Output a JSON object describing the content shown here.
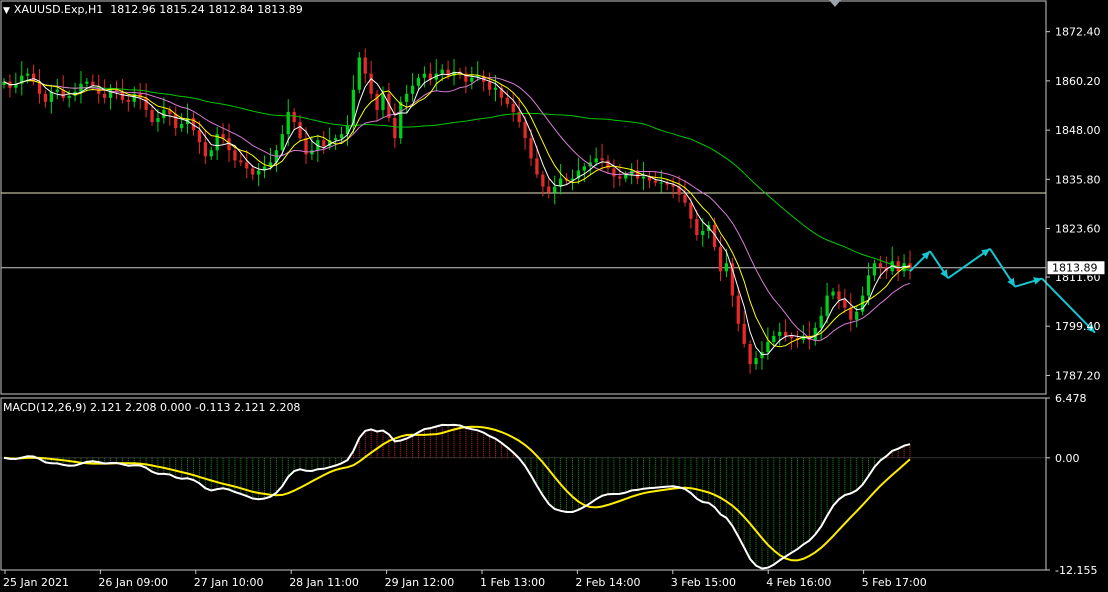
{
  "header": {
    "symbol_label": "XAUUSD.Exp,H1",
    "ohlc": "1812.96 1815.24 1812.84 1813.89"
  },
  "macd_header": "MACD(12,26,9) 2.121 2.208 0.000 -0.113 2.121 2.208",
  "colors": {
    "background": "#000000",
    "grid": "#c9c9c9",
    "bull_candle": "#00d21c",
    "bear_candle": "#e52a2a",
    "ma_fast": "#ffffff",
    "ma_yellow": "#ffff00",
    "ma_pink": "#d77bd7",
    "ma_green": "#00c800",
    "forecast_arrows": "#17c5d1",
    "macd_line": "#ffffff",
    "signal_line": "#ffee00",
    "hist_pos": "#d42a2a",
    "hist_neg": "#1c9a1c"
  },
  "chart_data": [
    {
      "type": "candlestick",
      "title": "XAUUSD.Exp,H1",
      "ylim": [
        1782.6,
        1880.0
      ],
      "y_ticks": [
        "1872.40",
        "1860.20",
        "1848.00",
        "1835.80",
        "1823.60",
        "1811.60",
        "1799.40",
        "1787.20"
      ],
      "current_price_label": "1813.89",
      "horizontal_lines": [
        1832.4,
        1813.89
      ],
      "x_tick_labels": [
        "25 Jan 2021",
        "26 Jan 09:00",
        "27 Jan 10:00",
        "28 Jan 11:00",
        "29 Jan 12:00",
        "1 Feb 13:00",
        "2 Feb 14:00",
        "3 Feb 15:00",
        "4 Feb 16:00",
        "5 Feb 17:00"
      ],
      "close_series": [
        1860.0,
        1858.5,
        1859.5,
        1861.5,
        1862.0,
        1860.0,
        1857.0,
        1855.0,
        1857.5,
        1858.0,
        1856.0,
        1856.5,
        1857.5,
        1859.5,
        1860.0,
        1859.0,
        1857.0,
        1856.0,
        1858.0,
        1857.5,
        1855.5,
        1855.0,
        1857.0,
        1856.0,
        1853.0,
        1850.0,
        1851.0,
        1853.0,
        1852.0,
        1848.5,
        1849.5,
        1851.0,
        1848.0,
        1845.0,
        1841.5,
        1843.0,
        1847.0,
        1846.0,
        1843.0,
        1840.5,
        1840.0,
        1838.5,
        1837.0,
        1838.0,
        1839.0,
        1840.0,
        1843.0,
        1847.0,
        1852.5,
        1850.0,
        1846.0,
        1842.0,
        1843.0,
        1845.5,
        1844.0,
        1845.5,
        1846.0,
        1847.0,
        1849.0,
        1858.0,
        1866.0,
        1862.0,
        1857.0,
        1853.0,
        1857.0,
        1851.0,
        1846.0,
        1855.0,
        1857.0,
        1859.0,
        1861.0,
        1862.0,
        1860.5,
        1862.0,
        1863.0,
        1861.5,
        1862.5,
        1862.0,
        1860.0,
        1861.0,
        1861.5,
        1860.0,
        1858.0,
        1858.5,
        1856.0,
        1854.5,
        1852.5,
        1850.0,
        1846.0,
        1841.0,
        1837.0,
        1834.0,
        1832.5,
        1834.0,
        1836.0,
        1835.5,
        1836.0,
        1838.0,
        1839.0,
        1840.0,
        1841.0,
        1840.5,
        1838.5,
        1836.5,
        1836.0,
        1837.0,
        1838.0,
        1836.0,
        1836.5,
        1835.5,
        1835.0,
        1835.0,
        1834.5,
        1834.0,
        1832.0,
        1830.0,
        1826.0,
        1822.0,
        1823.0,
        1824.5,
        1819.0,
        1813.0,
        1815.0,
        1807.0,
        1800.0,
        1795.0,
        1790.0,
        1791.5,
        1793.0,
        1795.5,
        1797.0,
        1798.0,
        1797.0,
        1796.5,
        1796.0,
        1797.0,
        1796.0,
        1799.0,
        1802.0,
        1807.0,
        1808.0,
        1806.0,
        1804.0,
        1801.0,
        1803.0,
        1807.0,
        1812.0,
        1815.0,
        1814.0,
        1813.0,
        1815.5,
        1813.0,
        1815.0,
        1813.89
      ],
      "moving_averages": [
        "ma_fast",
        "ma_yellow",
        "ma_pink",
        "ma_green"
      ],
      "forecast_path": [
        {
          "x": 910,
          "y": 1813.0
        },
        {
          "x": 930,
          "y": 1818.0
        },
        {
          "x": 948,
          "y": 1811.3
        },
        {
          "x": 990,
          "y": 1818.6
        },
        {
          "x": 1015,
          "y": 1809.2
        },
        {
          "x": 1042,
          "y": 1811.2
        },
        {
          "x": 1095,
          "y": 1797.8
        }
      ]
    },
    {
      "type": "macd",
      "title": "MACD(12,26,9)",
      "params": [
        12,
        26,
        9
      ],
      "values_shown": [
        2.121,
        2.208,
        0.0,
        -0.113,
        2.121,
        2.208
      ],
      "ylim": [
        -12.155,
        6.478
      ],
      "y_ticks": [
        "6.478",
        "0.00",
        "-12.155"
      ]
    }
  ]
}
